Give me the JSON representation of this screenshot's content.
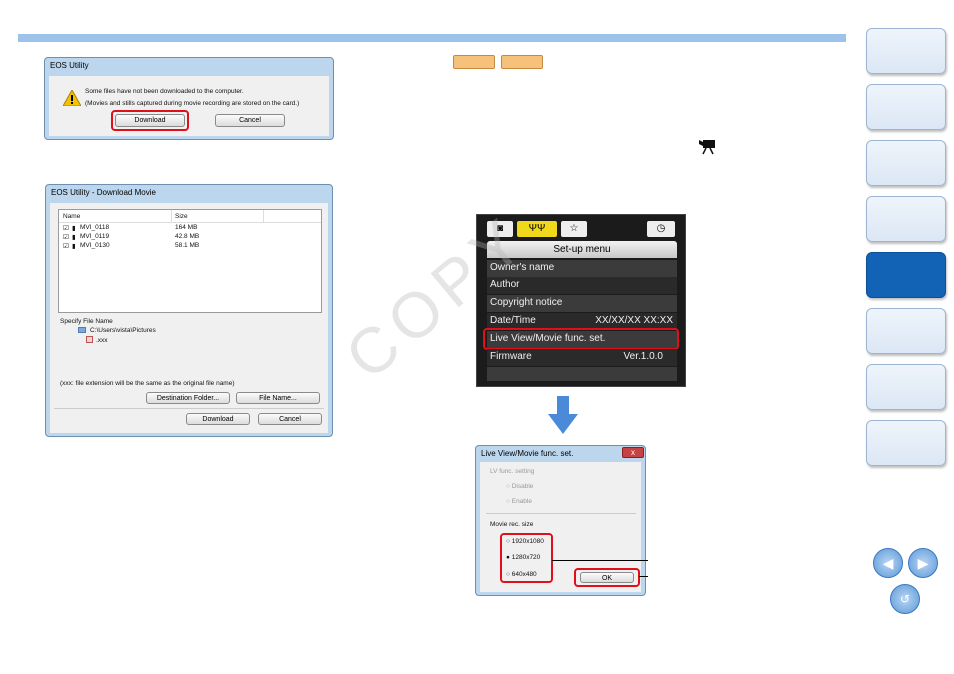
{
  "dialog1": {
    "title": "EOS Utility",
    "message1": "Some files have not been downloaded to the computer.",
    "message2": "(Movies and stills captured during movie recording are stored on the card.)",
    "download_button": "Download",
    "cancel_button": "Cancel"
  },
  "dialog2": {
    "title": "EOS Utility - Download Movie",
    "columns": [
      "Name",
      "Size"
    ],
    "files": [
      {
        "name": "MVI_0118",
        "size": "164 MB"
      },
      {
        "name": "MVI_0119",
        "size": "42.8 MB"
      },
      {
        "name": "MVI_0130",
        "size": "58.1 MB"
      }
    ],
    "specify_label": "Specify File Name",
    "path": "C:\\Users\\vista\\Pictures",
    "filename": ".xxx",
    "note": "(xxx: file extension will be the same as the original file name)",
    "dest_button": "Destination Folder...",
    "filename_button": "File Name...",
    "download_button": "Download",
    "cancel_button": "Cancel"
  },
  "camera_menu": {
    "header": "Set-up menu",
    "items": [
      {
        "label": "Owner's name",
        "value": ""
      },
      {
        "label": "Author",
        "value": ""
      },
      {
        "label": "Copyright notice",
        "value": ""
      },
      {
        "label": "Date/Time",
        "value": "XX/XX/XX  XX:XX"
      },
      {
        "label": "Live View/Movie func. set.",
        "value": ""
      },
      {
        "label": "Firmware",
        "value": "Ver.1.0.0"
      }
    ]
  },
  "dialog3": {
    "title": "Live View/Movie func. set.",
    "close": "x",
    "lv_group": "LV func. setting",
    "lv_options": [
      "Disable",
      "Enable"
    ],
    "movie_group": "Movie rec. size",
    "movie_options": [
      "1920x1080",
      "1280x720",
      "640x480"
    ],
    "ok_button": "OK"
  },
  "watermark": "COPY",
  "colors": {
    "accent_red": "#e0101a",
    "nav_active": "#1263b5",
    "top_bar": "#9ec3ea"
  }
}
